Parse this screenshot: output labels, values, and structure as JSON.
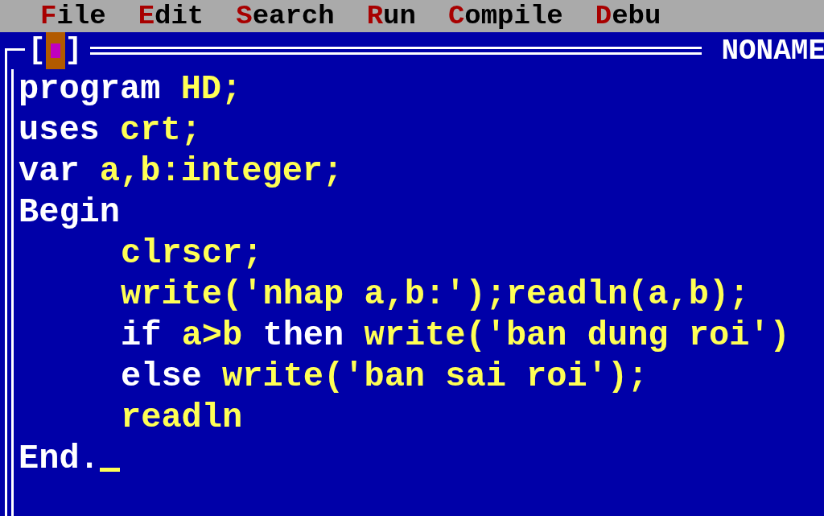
{
  "menu": [
    {
      "hotkey": "F",
      "rest": "ile"
    },
    {
      "hotkey": "E",
      "rest": "dit"
    },
    {
      "hotkey": "S",
      "rest": "earch"
    },
    {
      "hotkey": "R",
      "rest": "un"
    },
    {
      "hotkey": "C",
      "rest": "ompile"
    },
    {
      "hotkey": "D",
      "rest": "ebu"
    }
  ],
  "window": {
    "close_button": {
      "open": "[",
      "close": "]"
    },
    "title": "NONAME"
  },
  "editor": {
    "lines": [
      {
        "tokens": [
          {
            "kind": "keyword",
            "text": "program "
          },
          {
            "kind": "text",
            "text": "HD;"
          }
        ],
        "cursor": false
      },
      {
        "tokens": [
          {
            "kind": "keyword",
            "text": "uses "
          },
          {
            "kind": "text",
            "text": "crt;"
          }
        ],
        "cursor": false
      },
      {
        "tokens": [
          {
            "kind": "keyword",
            "text": "var "
          },
          {
            "kind": "text",
            "text": "a,b:integer;"
          }
        ],
        "cursor": false
      },
      {
        "tokens": [
          {
            "kind": "keyword",
            "text": "Begin"
          }
        ],
        "cursor": false,
        "children": [
          {
            "tokens": [
              {
                "kind": "text",
                "text": "clrscr;"
              }
            ],
            "cursor": false
          },
          {
            "tokens": [
              {
                "kind": "text",
                "text": "write('nhap a,b:');readln(a,b);"
              }
            ],
            "cursor": false
          },
          {
            "tokens": [
              {
                "kind": "keyword",
                "text": "if "
              },
              {
                "kind": "text",
                "text": "a>b "
              },
              {
                "kind": "keyword",
                "text": "then "
              },
              {
                "kind": "text",
                "text": "write('ban dung roi')"
              }
            ],
            "cursor": false
          },
          {
            "tokens": [
              {
                "kind": "keyword",
                "text": "else "
              },
              {
                "kind": "text",
                "text": "write('ban sai roi');"
              }
            ],
            "cursor": false
          },
          {
            "tokens": [
              {
                "kind": "text",
                "text": "readln"
              }
            ],
            "cursor": false
          }
        ]
      },
      {
        "tokens": [
          {
            "kind": "keyword",
            "text": "End."
          }
        ],
        "cursor": true
      }
    ]
  }
}
